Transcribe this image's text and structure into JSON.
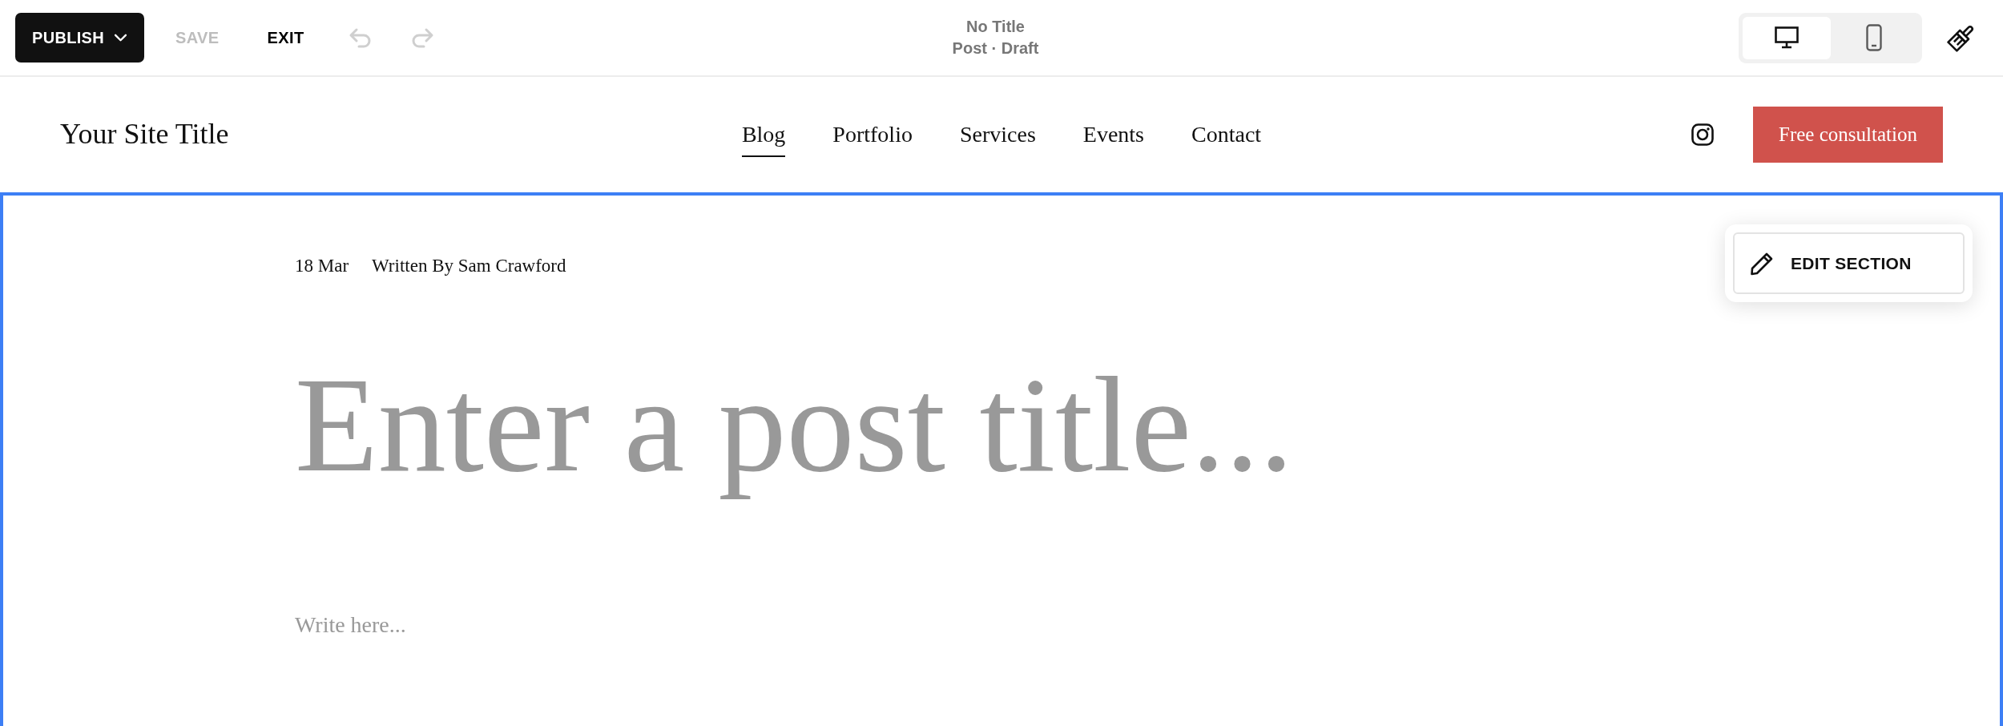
{
  "toolbar": {
    "publish": "PUBLISH",
    "save": {
      "label": "SAVE",
      "disabled": true
    },
    "exit": "EXIT",
    "undo": {
      "disabled": true
    },
    "redo": {
      "disabled": true
    }
  },
  "document": {
    "title": "No Title",
    "status": "Post · Draft"
  },
  "view_modes": [
    {
      "kind": "desktop",
      "selected": true
    },
    {
      "kind": "mobile",
      "selected": false
    }
  ],
  "site_header": {
    "title": "Your Site Title",
    "nav": [
      {
        "label": "Blog",
        "selected": true
      },
      {
        "label": "Portfolio",
        "selected": false
      },
      {
        "label": "Services",
        "selected": false
      },
      {
        "label": "Events",
        "selected": false
      },
      {
        "label": "Contact",
        "selected": false
      }
    ],
    "button": "Free consultation"
  },
  "section": {
    "selected": true,
    "edit_button": "EDIT SECTION",
    "date": "18 Mar",
    "byline": "Written By Sam Crawford",
    "post_title": {
      "placeholder": "Enter a post title..."
    },
    "body": {
      "placeholder": "Write here..."
    }
  }
}
